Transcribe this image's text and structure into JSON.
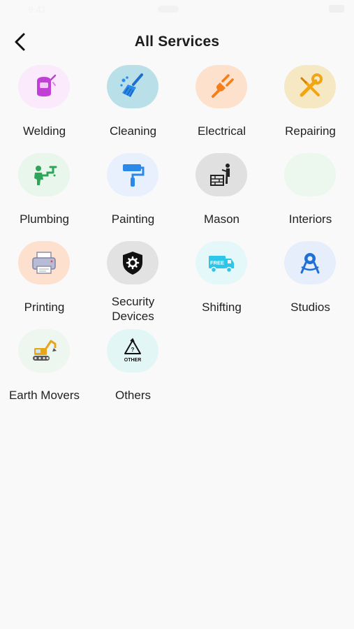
{
  "status": {
    "time": "9:41"
  },
  "header": {
    "title": "All Services"
  },
  "services": [
    {
      "label": "Welding",
      "bg": "#fbeafb"
    },
    {
      "label": "Cleaning",
      "bg": "#b9dfe8"
    },
    {
      "label": "Electrical",
      "bg": "#fde1cc"
    },
    {
      "label": "Repairing",
      "bg": "#f7e8c4"
    },
    {
      "label": "Plumbing",
      "bg": "#e9f6ec"
    },
    {
      "label": "Painting",
      "bg": "#e8f0fd"
    },
    {
      "label": "Mason",
      "bg": "#e0e0e0"
    },
    {
      "label": "Interiors",
      "bg": "#ecf7ee"
    },
    {
      "label": "Printing",
      "bg": "#fde0cd"
    },
    {
      "label": "Security",
      "label2": "Devices",
      "bg": "#e2e2e2"
    },
    {
      "label": "Shifting",
      "bg": "#e4f7f9"
    },
    {
      "label": "Studios",
      "bg": "#e7eefb"
    },
    {
      "label": "Earth Movers",
      "bg": "#edf6ef"
    },
    {
      "label": "Others",
      "bg": "#e3f6f6"
    }
  ],
  "icons": [
    "welding-mask-icon",
    "broom-icon",
    "plug-icon",
    "wrench-screwdriver-icon",
    "plumber-icon",
    "paint-roller-icon",
    "mason-icon",
    "interiors-icon",
    "printer-icon",
    "security-shield-icon",
    "free-delivery-truck-icon",
    "studio-compass-icon",
    "excavator-icon",
    "other-recycle-icon"
  ],
  "icon_text": {
    "free": "FREE",
    "other": "OTHER",
    "question": "?"
  }
}
